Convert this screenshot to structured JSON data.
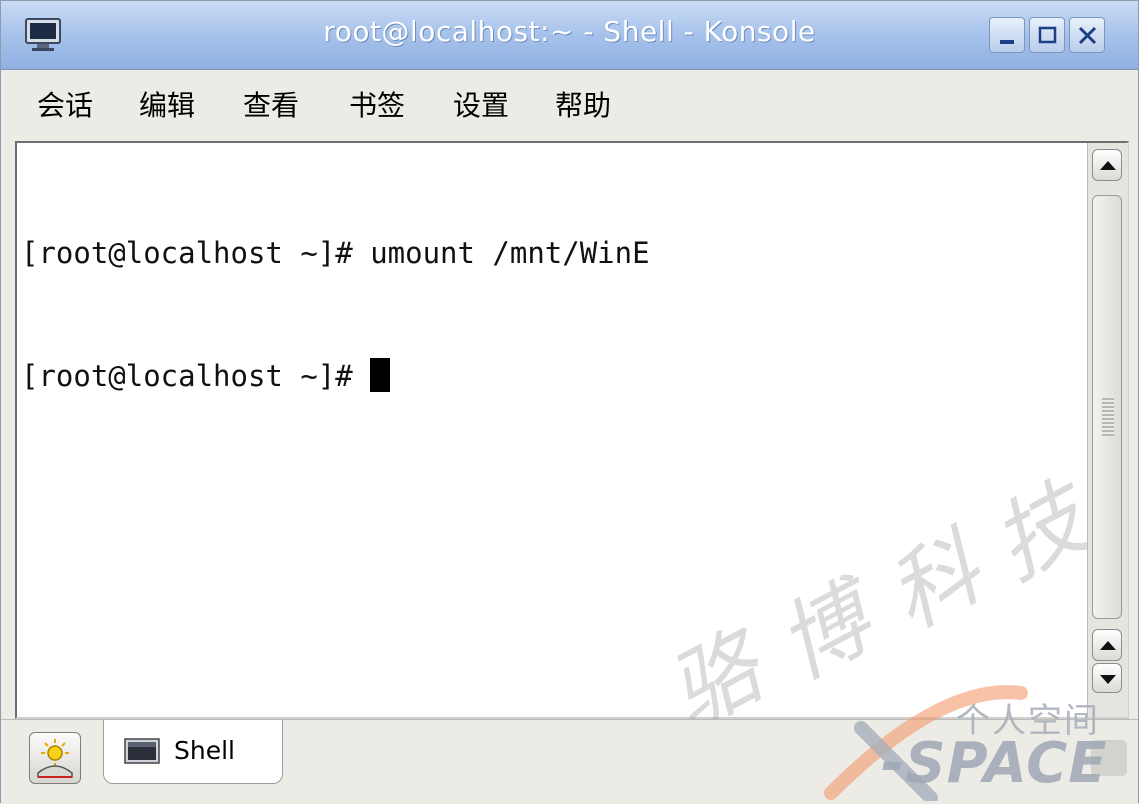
{
  "window": {
    "title": "root@localhost:~ - Shell - Konsole"
  },
  "menu": {
    "items": [
      "会话",
      "编辑",
      "查看",
      "书签",
      "设置",
      "帮助"
    ]
  },
  "terminal": {
    "lines": [
      "[root@localhost ~]# umount /mnt/WinE",
      "[root@localhost ~]# "
    ]
  },
  "tabs": [
    {
      "label": "Shell",
      "icon": "terminal-icon"
    }
  ],
  "watermark": {
    "brush_text": [
      "骆",
      "博",
      "科",
      "技"
    ],
    "line1": "个人空间",
    "line2": "-SPACE"
  },
  "colors": {
    "titlebar": "#a9c4ec",
    "terminal_bg": "#ffffff",
    "terminal_fg": "#111111"
  }
}
